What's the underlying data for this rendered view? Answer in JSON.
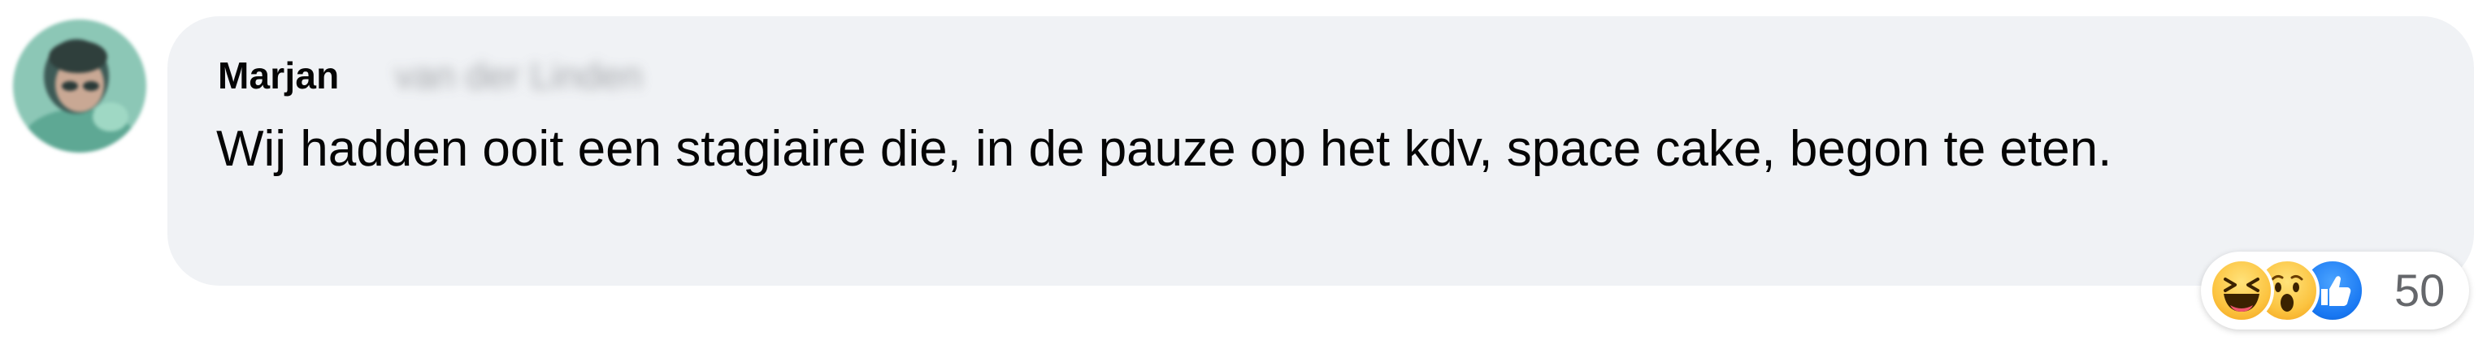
{
  "comment": {
    "author_first_name": "Marjan",
    "author_surname_blurred": "van der Linden",
    "text": "Wij hadden ooit een stagiaire die, in de pauze op het kdv, space cake, begon te eten.",
    "reactions": {
      "icons": [
        "haha-icon",
        "wow-icon",
        "like-icon"
      ],
      "count": "50"
    }
  },
  "colors": {
    "bubble_bg": "#f0f2f5",
    "text": "#050505",
    "muted": "#65676b",
    "like_blue": "#1877f2",
    "emoji_yellow": "#fcc441"
  }
}
